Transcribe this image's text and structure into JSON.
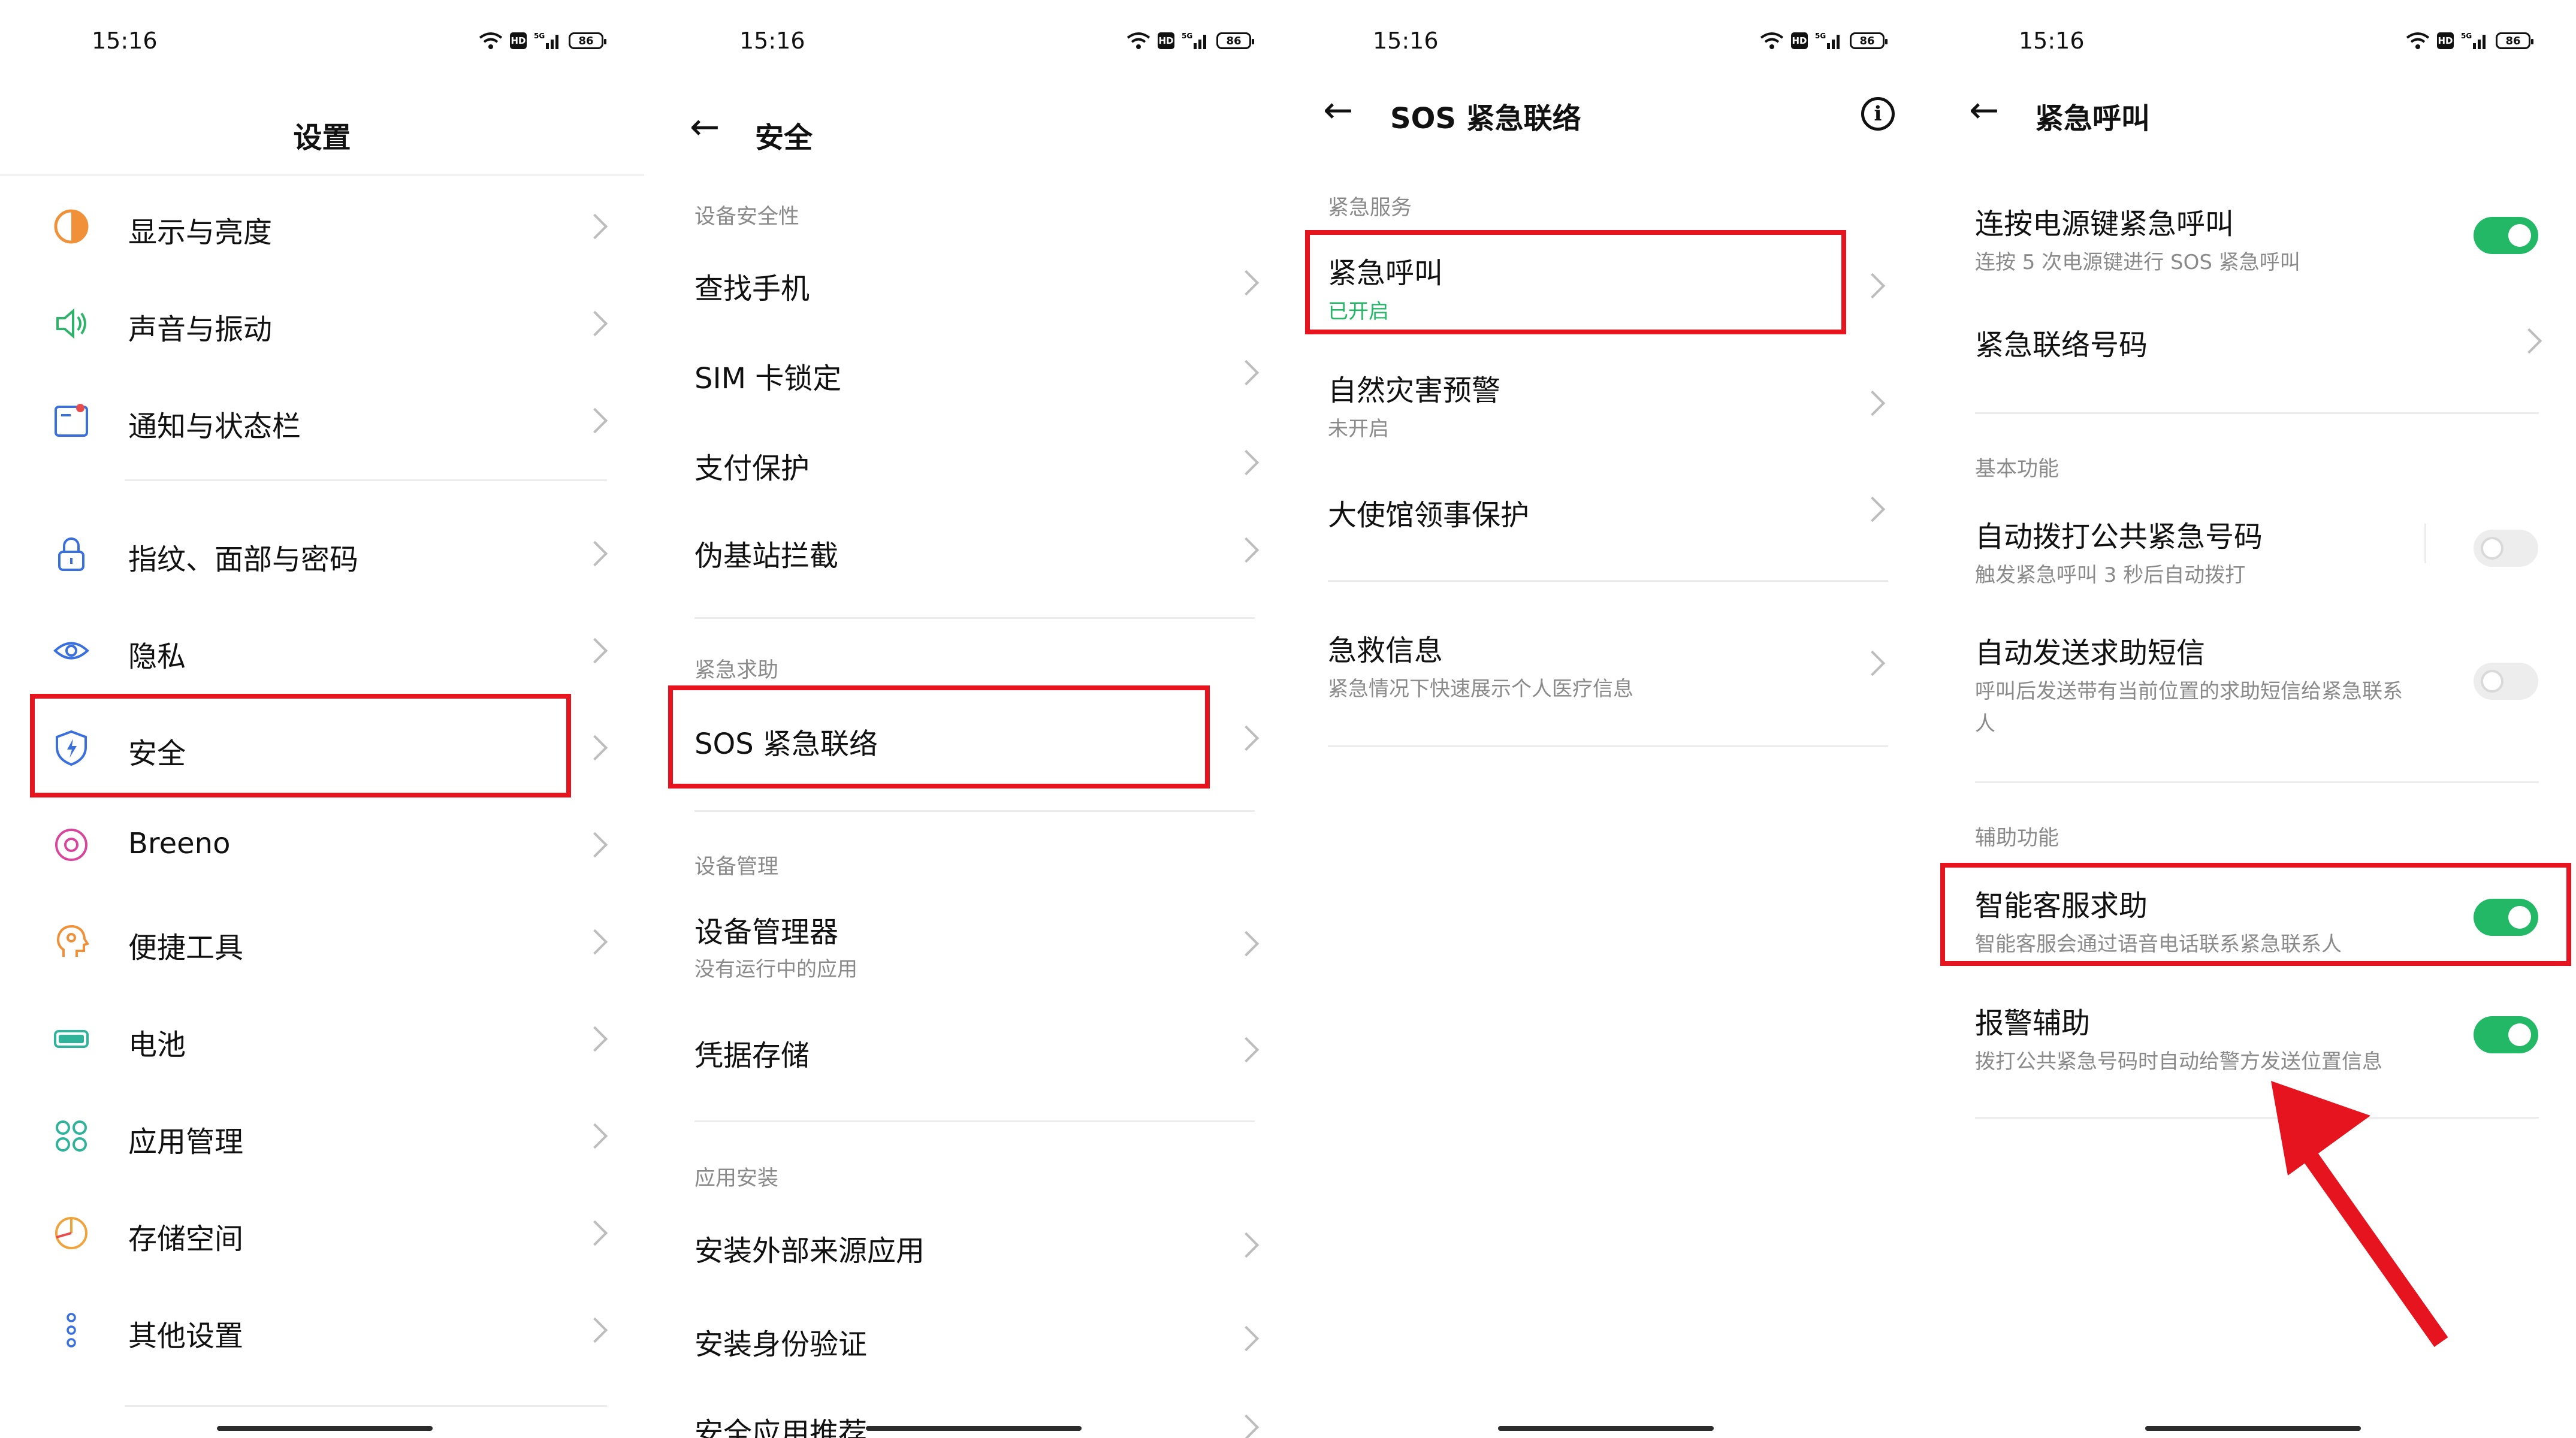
{
  "status_time": "15:16",
  "status_network": "5G",
  "status_hd": "HD",
  "battery_level": "86",
  "screen1": {
    "title": "设置",
    "items": [
      {
        "label": "显示与亮度",
        "icon": "display-brightness-icon"
      },
      {
        "label": "声音与振动",
        "icon": "sound-vibration-icon"
      },
      {
        "label": "通知与状态栏",
        "icon": "notification-icon"
      },
      {
        "label": "指纹、面部与密码",
        "icon": "lock-icon"
      },
      {
        "label": "隐私",
        "icon": "privacy-eye-icon"
      },
      {
        "label": "安全",
        "icon": "shield-icon"
      },
      {
        "label": "Breeno",
        "icon": "breeno-icon"
      },
      {
        "label": "便捷工具",
        "icon": "tools-head-icon"
      },
      {
        "label": "电池",
        "icon": "battery-icon"
      },
      {
        "label": "应用管理",
        "icon": "apps-grid-icon"
      },
      {
        "label": "存储空间",
        "icon": "storage-pie-icon"
      },
      {
        "label": "其他设置",
        "icon": "more-dots-icon"
      }
    ]
  },
  "screen2": {
    "title": "安全",
    "section_device_security": "设备安全性",
    "find_phone": "查找手机",
    "sim_lock": "SIM 卡锁定",
    "payment_protect": "支付保护",
    "fake_station_block": "伪基站拦截",
    "section_emergency": "紧急求助",
    "sos": "SOS 紧急联络",
    "section_device_mgmt": "设备管理",
    "device_manager": "设备管理器",
    "device_manager_sub": "没有运行中的应用",
    "credential_storage": "凭据存储",
    "section_app_install": "应用安装",
    "install_external": "安装外部来源应用",
    "install_verify": "安装身份验证",
    "safe_app_recommend": "安全应用推荐"
  },
  "screen3": {
    "title": "SOS 紧急联络",
    "section_services": "紧急服务",
    "emergency_call": "紧急呼叫",
    "emergency_call_status": "已开启",
    "disaster_warning": "自然灾害预警",
    "disaster_warning_status": "未开启",
    "embassy_protect": "大使馆领事保护",
    "medical_info": "急救信息",
    "medical_info_sub": "紧急情况下快速展示个人医疗信息"
  },
  "screen4": {
    "title": "紧急呼叫",
    "power_press": "连按电源键紧急呼叫",
    "power_press_sub": "连按 5 次电源键进行 SOS 紧急呼叫",
    "contact_number": "紧急联络号码",
    "section_basic": "基本功能",
    "auto_dial": "自动拨打公共紧急号码",
    "auto_dial_sub": "触发紧急呼叫 3 秒后自动拨打",
    "auto_sms": "自动发送求助短信",
    "auto_sms_sub_1": "呼叫后发送带有当前位置的求助短信给紧急联系",
    "auto_sms_sub_2": "人",
    "section_assist": "辅助功能",
    "smart_service": "智能客服求助",
    "smart_service_sub": "智能客服会通过语音电话联系紧急联系人",
    "police_assist": "报警辅助",
    "police_assist_sub": "拨打公共紧急号码时自动给警方发送位置信息",
    "toggles": {
      "power_press": true,
      "auto_dial": false,
      "auto_sms": false,
      "smart_service": true,
      "police_assist": true
    }
  },
  "colors": {
    "toggle_on": "#22b866",
    "highlight_red": "#e5141e",
    "status_green": "#22b866"
  }
}
